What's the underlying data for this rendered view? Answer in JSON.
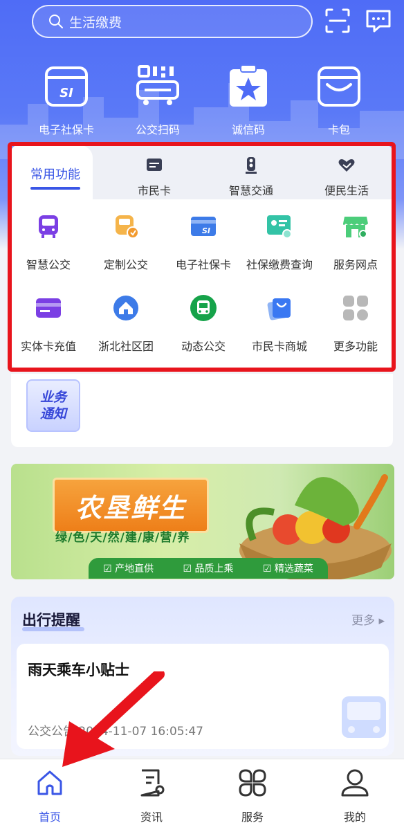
{
  "header": {
    "search_placeholder": "生活缴费",
    "icons": [
      "scan-icon",
      "message-icon"
    ]
  },
  "quick_actions": [
    {
      "label": "电子社保卡",
      "icon": "social-security-card-icon"
    },
    {
      "label": "公交扫码",
      "icon": "bus-qr-icon"
    },
    {
      "label": "诚信码",
      "icon": "credit-code-icon"
    },
    {
      "label": "卡包",
      "icon": "card-wallet-icon"
    }
  ],
  "function_panel": {
    "tabs": [
      {
        "label": "常用功能",
        "active": true
      },
      {
        "label": "市民卡",
        "icon": "citizen-card-icon"
      },
      {
        "label": "智慧交通",
        "icon": "traffic-light-icon"
      },
      {
        "label": "便民生活",
        "icon": "heart-hand-icon"
      }
    ],
    "items": [
      {
        "label": "智慧公交",
        "icon": "smart-bus-icon",
        "color": "#7b3fe4"
      },
      {
        "label": "定制公交",
        "icon": "custom-bus-icon",
        "color": "#f5b44a"
      },
      {
        "label": "电子社保卡",
        "icon": "social-security-card-icon",
        "color": "#3d7be8"
      },
      {
        "label": "社保缴费查询",
        "icon": "social-payment-query-icon",
        "color": "#33c3a6"
      },
      {
        "label": "服务网点",
        "icon": "service-outlet-icon",
        "color": "#4ccd7a"
      },
      {
        "label": "实体卡充值",
        "icon": "card-recharge-icon",
        "color": "#7b3fe4"
      },
      {
        "label": "浙北社区团",
        "icon": "community-group-icon",
        "color": "#3d7be8"
      },
      {
        "label": "动态公交",
        "icon": "dynamic-bus-icon",
        "color": "#16a34a"
      },
      {
        "label": "市民卡商城",
        "icon": "shopping-bag-icon",
        "color": "#3a78f2"
      },
      {
        "label": "更多功能",
        "icon": "more-grid-icon",
        "color": "#b8b8b8"
      }
    ]
  },
  "notice": {
    "line1": "业务",
    "line2": "通知"
  },
  "banner": {
    "title": "农垦鲜生",
    "slogan": "绿/色/天/然/建/康/营/养",
    "tags": [
      "☑ 产地直供",
      "☑ 品质上乘",
      "☑ 精选蔬菜"
    ]
  },
  "travel_reminder": {
    "title": "出行提醒",
    "more": "更多 ▸",
    "tip_title": "雨天乘车小贴士",
    "tip_meta": "公交公告  2024-11-07 16:05:47"
  },
  "bottom_nav": [
    {
      "label": "首页",
      "icon": "home-icon",
      "active": true
    },
    {
      "label": "资讯",
      "icon": "news-icon"
    },
    {
      "label": "服务",
      "icon": "services-icon"
    },
    {
      "label": "我的",
      "icon": "profile-icon"
    }
  ],
  "colors": {
    "primary": "#3a56e6",
    "highlight": "#e8141c"
  }
}
